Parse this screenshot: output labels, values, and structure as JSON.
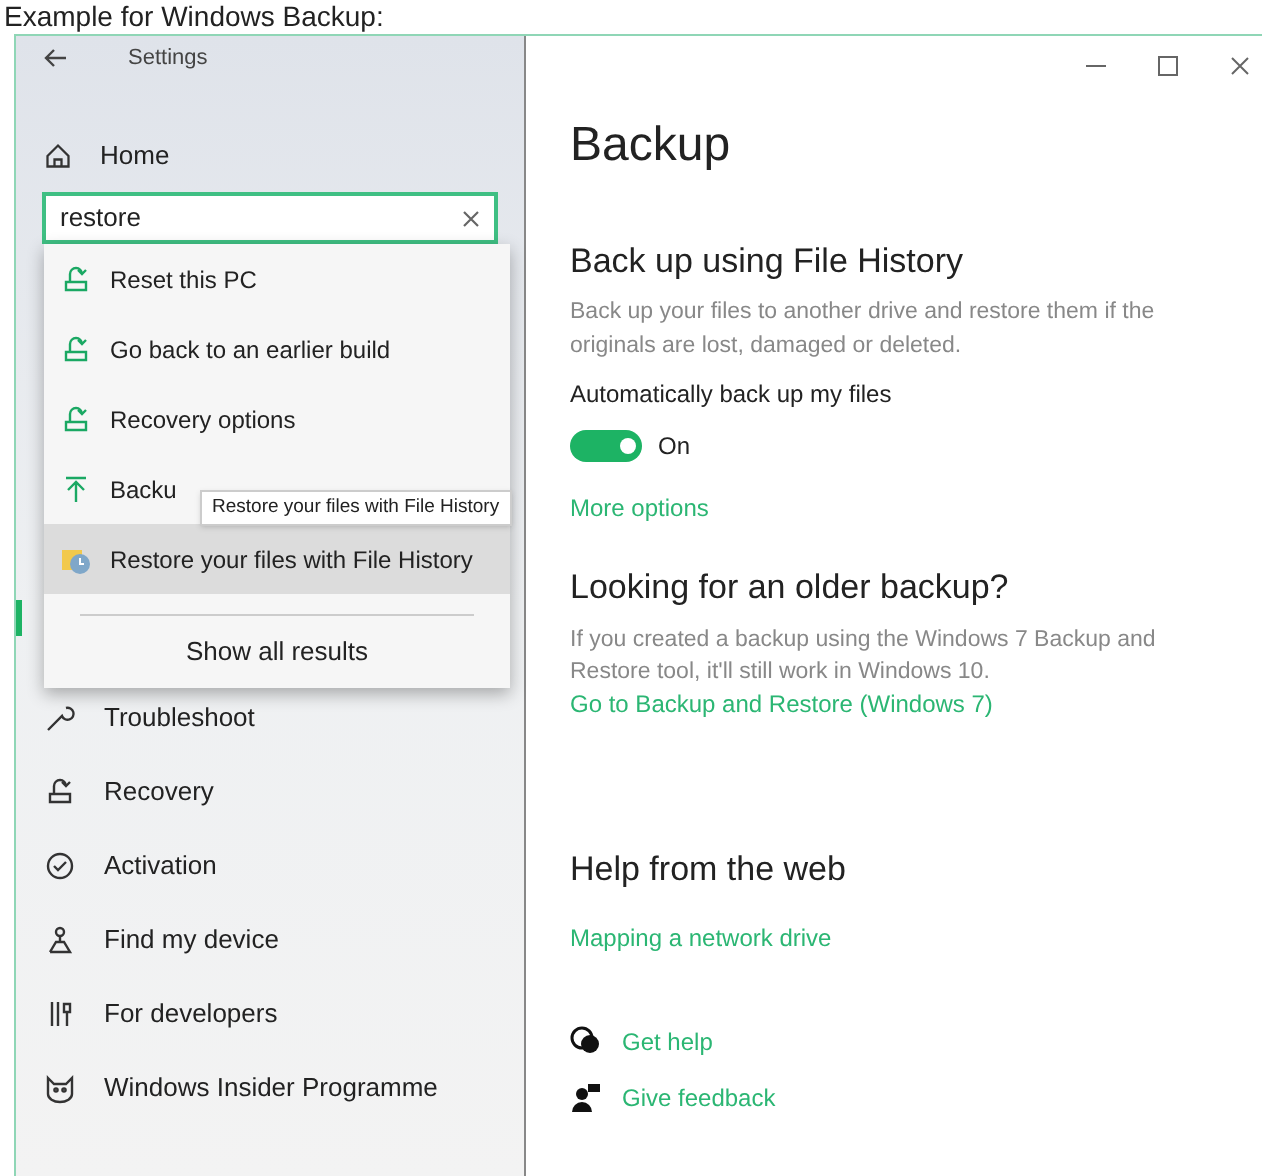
{
  "caption": "Example for Windows Backup:",
  "window": {
    "title": "Settings"
  },
  "sidebar": {
    "home": "Home",
    "search": {
      "value": "restore"
    },
    "items": [
      {
        "label": "Troubleshoot"
      },
      {
        "label": "Recovery"
      },
      {
        "label": "Activation"
      },
      {
        "label": "Find my device"
      },
      {
        "label": "For developers"
      },
      {
        "label": "Windows Insider Programme"
      }
    ]
  },
  "search_results": {
    "items": [
      {
        "label": "Reset this PC",
        "selected": false
      },
      {
        "label": "Go back to an earlier build",
        "selected": false
      },
      {
        "label": "Recovery options",
        "selected": false
      },
      {
        "label": "Backu",
        "selected": false
      },
      {
        "label": "Restore your files with File History",
        "selected": true
      }
    ],
    "show_all": "Show all results",
    "tooltip": "Restore your files with File History"
  },
  "main": {
    "title": "Backup",
    "file_history": {
      "heading": "Back up using File History",
      "description": "Back up your files to another drive and restore them if the originals are lost, damaged or deleted.",
      "toggle_label": "Automatically back up my files",
      "toggle": {
        "on": true,
        "label": "On"
      },
      "link": "More options"
    },
    "older_backup": {
      "heading": "Looking for an older backup?",
      "description": "If you created a backup using the Windows 7 Backup and Restore tool, it'll still work in Windows 10.",
      "link": "Go to Backup and Restore (Windows 7)"
    },
    "help": {
      "heading": "Help from the web",
      "link": "Mapping a network drive"
    },
    "actions": [
      {
        "label": "Get help"
      },
      {
        "label": "Give feedback"
      }
    ]
  }
}
